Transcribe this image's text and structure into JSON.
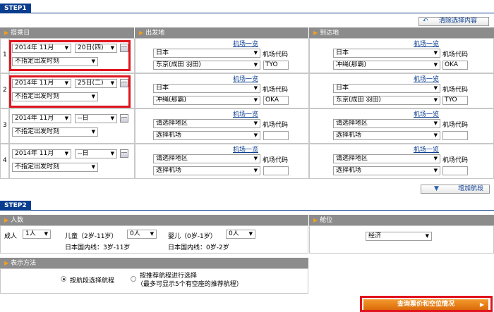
{
  "step1": {
    "label": "STEP1"
  },
  "clear_button": {
    "label": "清除选择内容"
  },
  "headers": {
    "date": "搭乘日",
    "from": "出发地",
    "to": "到达地"
  },
  "segments": [
    {
      "num": "1",
      "month": "2014年 11月",
      "day": "20日(四)",
      "time": "不指定出发时刻",
      "airport_link": "机场一览",
      "code_label": "机场代码",
      "from_region": "日本",
      "from_airport": "东京(成田 羽田)",
      "from_code": "TYO",
      "to_region": "日本",
      "to_airport": "冲绳(那霸)",
      "to_code": "OKA"
    },
    {
      "num": "2",
      "month": "2014年 11月",
      "day": "25日(二)",
      "time": "不指定出发时刻",
      "airport_link": "机场一览",
      "code_label": "机场代码",
      "from_region": "日本",
      "from_airport": "冲绳(那霸)",
      "from_code": "OKA",
      "to_region": "日本",
      "to_airport": "东京(成田 羽田)",
      "to_code": "TYO"
    },
    {
      "num": "3",
      "month": "2014年 11月",
      "day": "--日",
      "time": "不指定出发时刻",
      "airport_link": "机场一览",
      "code_label": "机场代码",
      "from_region": "请选择地区",
      "from_airport": "选择机场",
      "from_code": "",
      "to_region": "请选择地区",
      "to_airport": "选择机场",
      "to_code": ""
    },
    {
      "num": "4",
      "month": "2014年 11月",
      "day": "--日",
      "time": "不指定出发时刻",
      "airport_link": "机场一览",
      "code_label": "机场代码",
      "from_region": "请选择地区",
      "from_airport": "选择机场",
      "from_code": "",
      "to_region": "请选择地区",
      "to_airport": "选择机场",
      "to_code": ""
    }
  ],
  "add_button": {
    "label": "增加航段"
  },
  "step2": {
    "label": "STEP2"
  },
  "pax": {
    "header": "人数",
    "adult_label": "成人",
    "adult_value": "1人",
    "child_label": "儿童（2岁-11岁）",
    "child_value": "0人",
    "child_note": "日本国内线：3岁-11岁",
    "infant_label": "婴儿（0岁-1岁）",
    "infant_value": "0人",
    "infant_note": "日本国内线：0岁-2岁"
  },
  "cabin": {
    "header": "舱位",
    "value": "经济"
  },
  "display": {
    "header": "表示方法",
    "option1": "按航段选择航程",
    "option2_line1": "按推荐航程进行选择",
    "option2_line2": "（最多可显示5个有空座的推荐航程）"
  },
  "search_button": {
    "label": "查询票价和空位情况"
  },
  "colors": {
    "step_bg": "#0a3d8f",
    "header_bg": "#8c8c8c",
    "highlight": "#e0141e",
    "search_btn": "#e87d14"
  }
}
